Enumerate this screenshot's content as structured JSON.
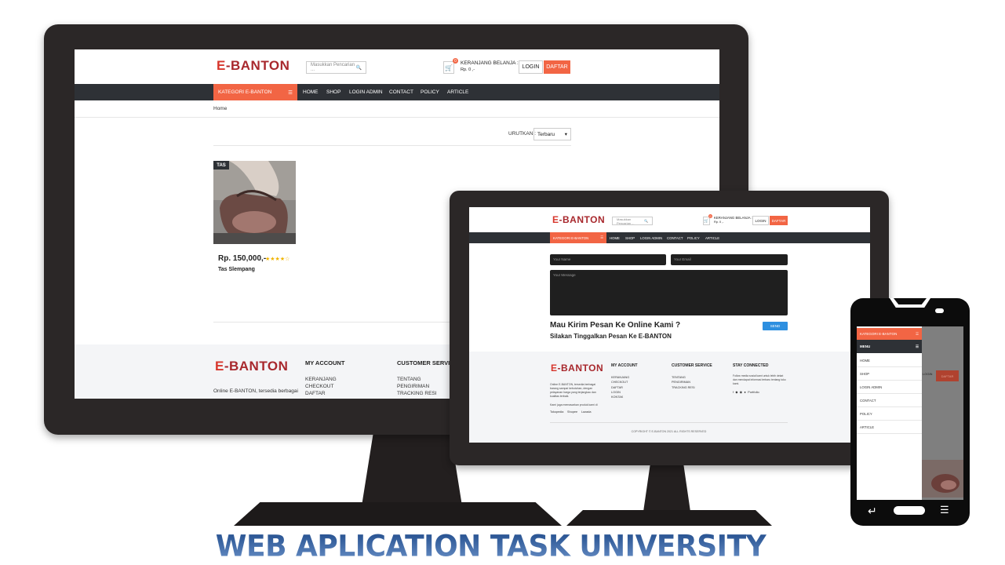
{
  "brand": {
    "logo_e": "E",
    "logo_rest": "-BANTON"
  },
  "search": {
    "placeholder": "Masukkan Pencarian ..."
  },
  "cart": {
    "count": "0",
    "label": "KERANJANG BELANJA :",
    "total": "Rp. 0 ,-"
  },
  "auth": {
    "login": "LOGIN",
    "daftar": "DAFTAR"
  },
  "nav": {
    "kategori": "KATEGORI E-BANTON",
    "links": [
      "HOME",
      "SHOP",
      "LOGIN ADMIN",
      "CONTACT",
      "POLICY",
      "ARTICLE"
    ]
  },
  "breadcrumb": "Home",
  "sort": {
    "label": "URUTKAN :",
    "value": "Terbaru"
  },
  "product": {
    "tag": "TAS",
    "price": "Rp. 150,000,-",
    "rating_stars": "★★★★☆",
    "name": "Tas Slempang"
  },
  "footer": {
    "about_line": "Online E-BANTON, tersedia berbagai",
    "my_account": {
      "title": "MY ACCOUNT",
      "items": [
        "KERANJANG",
        "CHECKOUT",
        "DAFTAR",
        "LOGIN",
        "KONTAK"
      ]
    },
    "customer_service": {
      "title": "CUSTOMER SERVICE",
      "title_cut": "CUSTOMER SERVIC",
      "items": [
        "TENTANG",
        "PENGIRIMAN",
        "TRACKING RESI"
      ]
    },
    "stay_connected": {
      "title": "STAY CONNECTED",
      "text": "Follow media sosial kami untuk lebih dekat dan mendapat informasi terbaru tentang toko kami.",
      "portfolio": "Portfolio"
    },
    "tablet_about": "Online E-BANTON, tersedia berbagai barang sampai kebutuhan, dengan pelayanan harga yang terjangkau dan kualitas terbaik.",
    "tablet_find": "Kami juga memasarkan produk kami di",
    "marketplaces": [
      "Tokopedia",
      "Shopee",
      "Lazada"
    ],
    "copyright": "COPYRIGHT © E-BANTON 2021 ALL RIGHTS RESERVED"
  },
  "contact": {
    "name_placeholder": "Your Name",
    "email_placeholder": "Your Email",
    "message_placeholder": "Your Message",
    "heading": "Mau Kirim Pesan Ke Online Kami ?",
    "subheading": "Silakan Tinggalkan Pesan Ke E-BANTON",
    "send": "SEND"
  },
  "mobile_menu": {
    "kategori": "KATEGORI E-BANTON",
    "menu": "MENU",
    "items": [
      "HOME",
      "SHOP",
      "LOGIN ADMIN",
      "CONTACT",
      "POLICY",
      "ARTICLE"
    ]
  },
  "title": "WEB APLICATION TASK UNIVERSITY",
  "colors": {
    "accent": "#f26544",
    "nav": "#2e3136",
    "frame": "#2b2727",
    "title": "#2a5598"
  }
}
